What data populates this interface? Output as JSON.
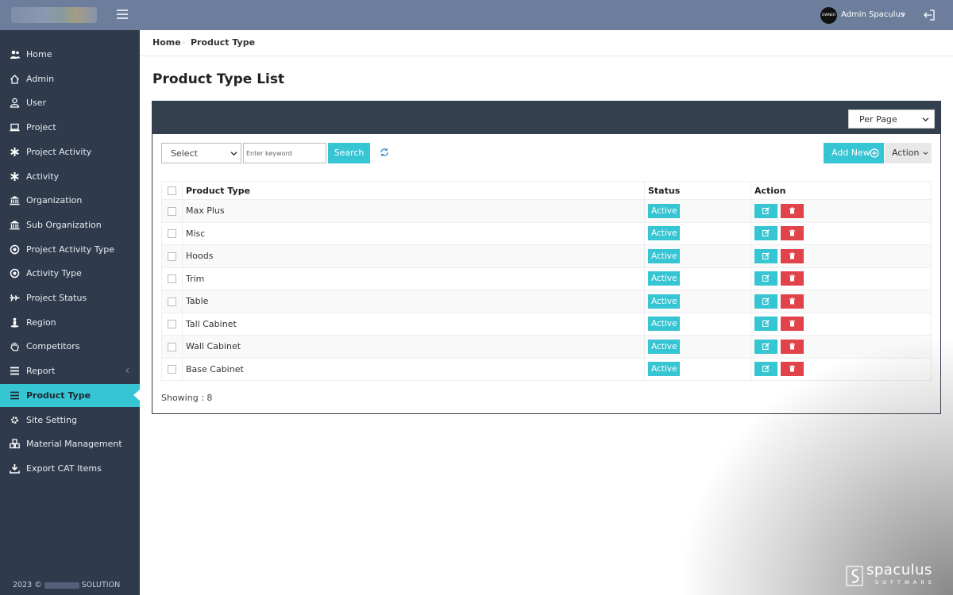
{
  "header": {
    "avatar_text": "OWNER",
    "user_name": "Admin Spaculus"
  },
  "sidebar": {
    "items": [
      {
        "label": "Home",
        "icon": "users-icon"
      },
      {
        "label": "Admin",
        "icon": "home-icon"
      },
      {
        "label": "User",
        "icon": "user-icon"
      },
      {
        "label": "Project",
        "icon": "laptop-icon"
      },
      {
        "label": "Project Activity",
        "icon": "asterisk-icon"
      },
      {
        "label": "Activity",
        "icon": "asterisk-icon"
      },
      {
        "label": "Organization",
        "icon": "bank-icon"
      },
      {
        "label": "Sub Organization",
        "icon": "bank-icon"
      },
      {
        "label": "Project Activity Type",
        "icon": "dot-circle-icon"
      },
      {
        "label": "Activity Type",
        "icon": "dot-circle-icon"
      },
      {
        "label": "Project Status",
        "icon": "plane-icon"
      },
      {
        "label": "Region",
        "icon": "street-view-icon"
      },
      {
        "label": "Competitors",
        "icon": "hand-icon"
      },
      {
        "label": "Report",
        "icon": "list-icon"
      },
      {
        "label": "Product Type",
        "icon": "list-icon"
      },
      {
        "label": "Site Setting",
        "icon": "gear-icon"
      },
      {
        "label": "Material Management",
        "icon": "cubes-icon"
      },
      {
        "label": "Export CAT Items",
        "icon": "download-icon"
      }
    ],
    "active": "Product Type",
    "footer_year": "2023 ©",
    "footer_suffix": "SOLUTION"
  },
  "breadcrumb": {
    "home": "Home",
    "current": "Product Type"
  },
  "page": {
    "title": "Product Type List"
  },
  "toolbar": {
    "per_page": "Per Page",
    "filter_select": "Select",
    "keyword_placeholder": "Enter keyword",
    "search": "Search",
    "add_new": "Add New",
    "action": "Action"
  },
  "table": {
    "headers": {
      "product_type": "Product Type",
      "status": "Status",
      "action": "Action"
    },
    "rows": [
      {
        "name": "Max Plus",
        "status": "Active"
      },
      {
        "name": "Misc",
        "status": "Active"
      },
      {
        "name": "Hoods",
        "status": "Active"
      },
      {
        "name": "Trim",
        "status": "Active"
      },
      {
        "name": "Table",
        "status": "Active"
      },
      {
        "name": "Tall Cabinet",
        "status": "Active"
      },
      {
        "name": "Wall Cabinet",
        "status": "Active"
      },
      {
        "name": "Base Cabinet",
        "status": "Active"
      }
    ],
    "showing": "Showing : 8"
  },
  "watermark": {
    "brand": "spaculus",
    "sub": "SOFTWARE"
  },
  "colors": {
    "accent": "#36c5d3",
    "danger": "#e1434b",
    "sidebar": "#2f3b4c",
    "topbar": "#6d7e9c"
  }
}
